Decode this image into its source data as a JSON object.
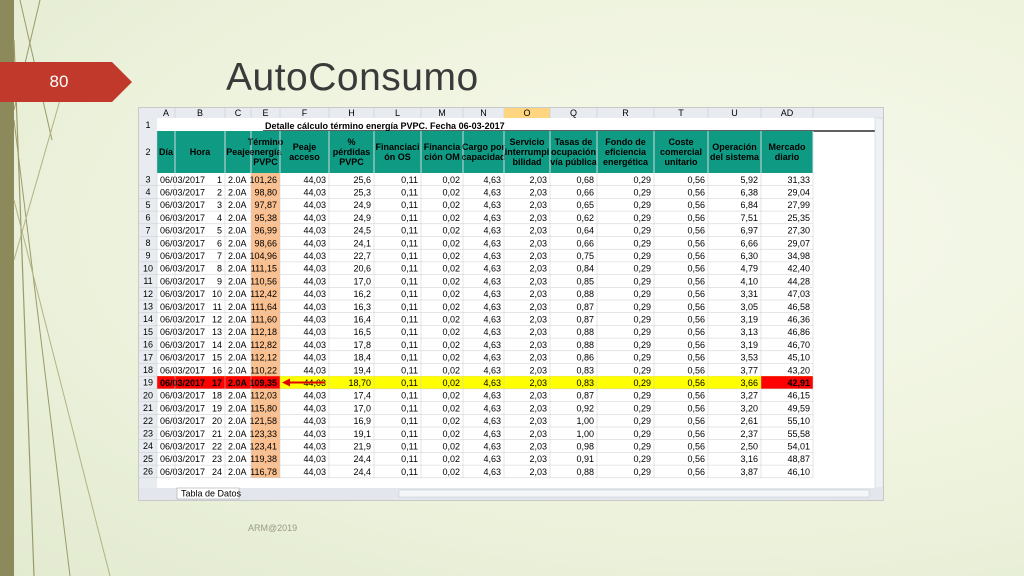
{
  "slide": {
    "title": "AutoConsumo",
    "page_number": "80",
    "footer": "ARM@2019"
  },
  "colors": {
    "accent_red": "#c0392b",
    "header_teal": "#0f9a83",
    "pvpc_orange": "#fac090",
    "highlight_yellow": "#ffff00",
    "highlight_red": "#ff0000"
  },
  "sheet": {
    "title": "Detalle cálculo término energía PVPC. Fecha 06-03-2017",
    "col_letters": [
      "A",
      "B",
      "C",
      "E",
      "F",
      "H",
      "L",
      "M",
      "N",
      "O",
      "Q",
      "R",
      "T",
      "U",
      "AD"
    ],
    "selected_col": "O",
    "headers": [
      "Día",
      "Hora",
      "Peaje",
      "Término energía PVPC",
      "Peaje acceso",
      "% pérdidas PVPC",
      "Financiación OS",
      "Financiación OM",
      "Cargo por capacidad",
      "Servicio interrumpibilidad",
      "Tasas de ocupación vía pública",
      "Fondo de eficiencia energética",
      "Coste comercial unitario",
      "Operación del sistema",
      "Mercado diario"
    ],
    "header_lines": [
      [
        "Día"
      ],
      [
        "Hora"
      ],
      [
        "Peaje"
      ],
      [
        "Término",
        "energía",
        "PVPC"
      ],
      [
        "Peaje",
        "acceso"
      ],
      [
        "%",
        "pérdidas",
        "PVPC"
      ],
      [
        "Financiaci",
        "ón OS"
      ],
      [
        "Financia",
        "ción OM"
      ],
      [
        "Cargo por",
        "capacidad"
      ],
      [
        "Servicio",
        "interrumpi",
        "bilidad"
      ],
      [
        "Tasas de",
        "ocupación",
        "vía pública"
      ],
      [
        "Fondo de",
        "eficiencia",
        "energética"
      ],
      [
        "Coste",
        "comercial",
        "unitario"
      ],
      [
        "Operación",
        "del sistema"
      ],
      [
        "Mercado",
        "diario"
      ]
    ],
    "rows": [
      [
        "06/03/2017",
        "1",
        "2.0A",
        "101,26",
        "44,03",
        "25,6",
        "0,11",
        "0,02",
        "4,63",
        "2,03",
        "0,68",
        "0,29",
        "0,56",
        "5,92",
        "31,33"
      ],
      [
        "06/03/2017",
        "2",
        "2.0A",
        "98,80",
        "44,03",
        "25,3",
        "0,11",
        "0,02",
        "4,63",
        "2,03",
        "0,66",
        "0,29",
        "0,56",
        "6,38",
        "29,04"
      ],
      [
        "06/03/2017",
        "3",
        "2.0A",
        "97,87",
        "44,03",
        "24,9",
        "0,11",
        "0,02",
        "4,63",
        "2,03",
        "0,65",
        "0,29",
        "0,56",
        "6,84",
        "27,99"
      ],
      [
        "06/03/2017",
        "4",
        "2.0A",
        "95,38",
        "44,03",
        "24,9",
        "0,11",
        "0,02",
        "4,63",
        "2,03",
        "0,62",
        "0,29",
        "0,56",
        "7,51",
        "25,35"
      ],
      [
        "06/03/2017",
        "5",
        "2.0A",
        "96,99",
        "44,03",
        "24,5",
        "0,11",
        "0,02",
        "4,63",
        "2,03",
        "0,64",
        "0,29",
        "0,56",
        "6,97",
        "27,30"
      ],
      [
        "06/03/2017",
        "6",
        "2.0A",
        "98,66",
        "44,03",
        "24,1",
        "0,11",
        "0,02",
        "4,63",
        "2,03",
        "0,66",
        "0,29",
        "0,56",
        "6,66",
        "29,07"
      ],
      [
        "06/03/2017",
        "7",
        "2.0A",
        "104,96",
        "44,03",
        "22,7",
        "0,11",
        "0,02",
        "4,63",
        "2,03",
        "0,75",
        "0,29",
        "0,56",
        "6,30",
        "34,98"
      ],
      [
        "06/03/2017",
        "8",
        "2.0A",
        "111,15",
        "44,03",
        "20,6",
        "0,11",
        "0,02",
        "4,63",
        "2,03",
        "0,84",
        "0,29",
        "0,56",
        "4,79",
        "42,40"
      ],
      [
        "06/03/2017",
        "9",
        "2.0A",
        "110,56",
        "44,03",
        "17,0",
        "0,11",
        "0,02",
        "4,63",
        "2,03",
        "0,85",
        "0,29",
        "0,56",
        "4,10",
        "44,28"
      ],
      [
        "06/03/2017",
        "10",
        "2.0A",
        "112,42",
        "44,03",
        "16,2",
        "0,11",
        "0,02",
        "4,63",
        "2,03",
        "0,88",
        "0,29",
        "0,56",
        "3,31",
        "47,03"
      ],
      [
        "06/03/2017",
        "11",
        "2.0A",
        "111,64",
        "44,03",
        "16,3",
        "0,11",
        "0,02",
        "4,63",
        "2,03",
        "0,87",
        "0,29",
        "0,56",
        "3,05",
        "46,58"
      ],
      [
        "06/03/2017",
        "12",
        "2.0A",
        "111,60",
        "44,03",
        "16,4",
        "0,11",
        "0,02",
        "4,63",
        "2,03",
        "0,87",
        "0,29",
        "0,56",
        "3,19",
        "46,36"
      ],
      [
        "06/03/2017",
        "13",
        "2.0A",
        "112,18",
        "44,03",
        "16,5",
        "0,11",
        "0,02",
        "4,63",
        "2,03",
        "0,88",
        "0,29",
        "0,56",
        "3,13",
        "46,86"
      ],
      [
        "06/03/2017",
        "14",
        "2.0A",
        "112,82",
        "44,03",
        "17,8",
        "0,11",
        "0,02",
        "4,63",
        "2,03",
        "0,88",
        "0,29",
        "0,56",
        "3,19",
        "46,70"
      ],
      [
        "06/03/2017",
        "15",
        "2.0A",
        "112,12",
        "44,03",
        "18,4",
        "0,11",
        "0,02",
        "4,63",
        "2,03",
        "0,86",
        "0,29",
        "0,56",
        "3,53",
        "45,10"
      ],
      [
        "06/03/2017",
        "16",
        "2.0A",
        "110,22",
        "44,03",
        "19,4",
        "0,11",
        "0,02",
        "4,63",
        "2,03",
        "0,83",
        "0,29",
        "0,56",
        "3,77",
        "43,20"
      ],
      [
        "06/03/2017",
        "17",
        "2.0A",
        "109,35",
        "44,03",
        "18,70",
        "0,11",
        "0,02",
        "4,63",
        "2,03",
        "0,83",
        "0,29",
        "0,56",
        "3,66",
        "42,91"
      ],
      [
        "06/03/2017",
        "18",
        "2.0A",
        "112,03",
        "44,03",
        "17,4",
        "0,11",
        "0,02",
        "4,63",
        "2,03",
        "0,87",
        "0,29",
        "0,56",
        "3,27",
        "46,15"
      ],
      [
        "06/03/2017",
        "19",
        "2.0A",
        "115,80",
        "44,03",
        "17,0",
        "0,11",
        "0,02",
        "4,63",
        "2,03",
        "0,92",
        "0,29",
        "0,56",
        "3,20",
        "49,59"
      ],
      [
        "06/03/2017",
        "20",
        "2.0A",
        "121,58",
        "44,03",
        "16,9",
        "0,11",
        "0,02",
        "4,63",
        "2,03",
        "1,00",
        "0,29",
        "0,56",
        "2,61",
        "55,10"
      ],
      [
        "06/03/2017",
        "21",
        "2.0A",
        "123,33",
        "44,03",
        "19,1",
        "0,11",
        "0,02",
        "4,63",
        "2,03",
        "1,00",
        "0,29",
        "0,56",
        "2,37",
        "55,58"
      ],
      [
        "06/03/2017",
        "22",
        "2.0A",
        "123,41",
        "44,03",
        "21,9",
        "0,11",
        "0,02",
        "4,63",
        "2,03",
        "0,98",
        "0,29",
        "0,56",
        "2,50",
        "54,01"
      ],
      [
        "06/03/2017",
        "23",
        "2.0A",
        "119,38",
        "44,03",
        "24,4",
        "0,11",
        "0,02",
        "4,63",
        "2,03",
        "0,91",
        "0,29",
        "0,56",
        "3,16",
        "48,87"
      ],
      [
        "06/03/2017",
        "24",
        "2.0A",
        "116,78",
        "44,03",
        "24,4",
        "0,11",
        "0,02",
        "4,63",
        "2,03",
        "0,88",
        "0,29",
        "0,56",
        "3,87",
        "46,10"
      ]
    ],
    "highlight_hour": "17",
    "sheet_tab": "Tabla de Datos"
  }
}
